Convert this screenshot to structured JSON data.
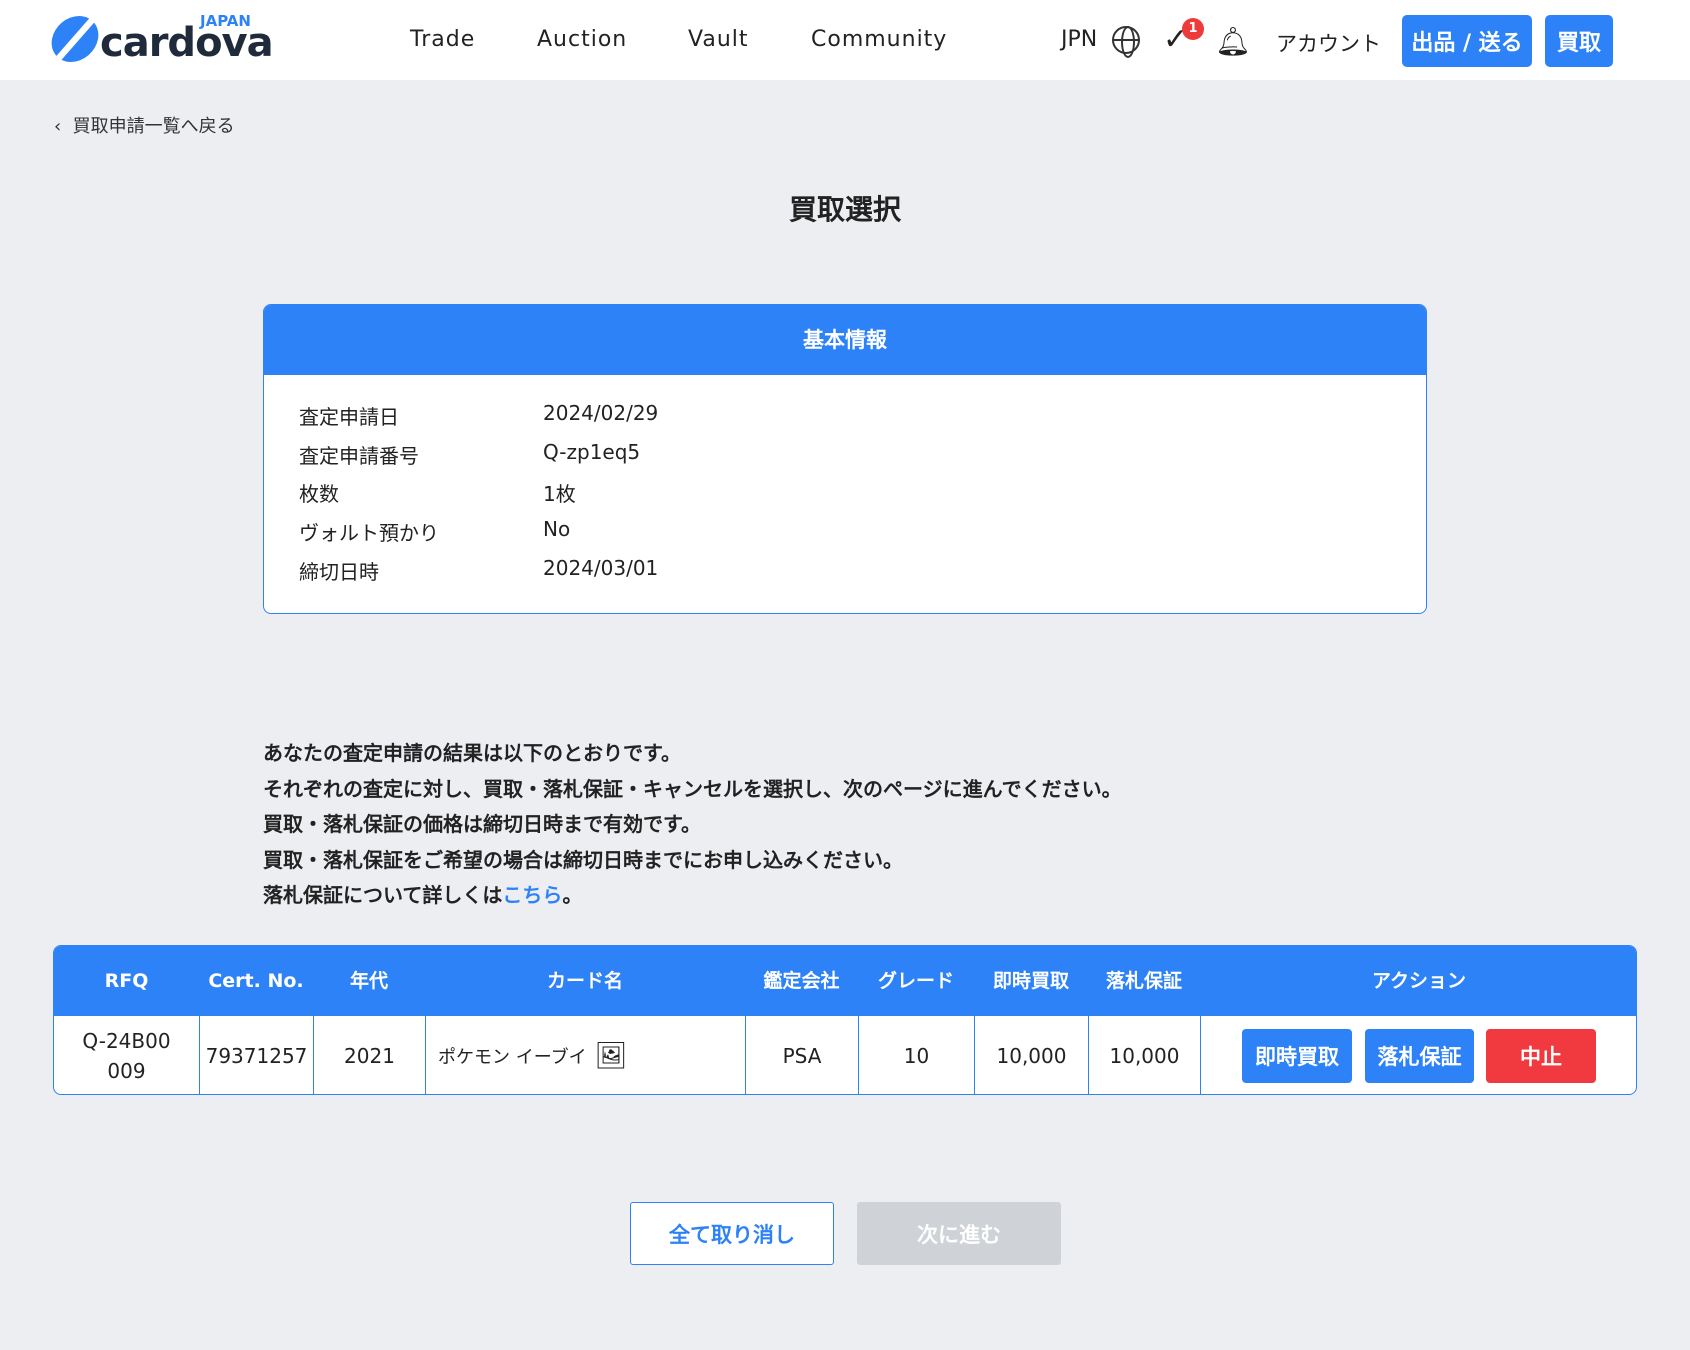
{
  "header": {
    "logo_text": "cardova",
    "logo_sub": "JAPAN",
    "nav": [
      "Trade",
      "Auction",
      "Vault",
      "Community"
    ],
    "lang": "JPN",
    "notif_count": "1",
    "account": "アカウント",
    "sell_button": "出品 / 送る",
    "buy_button": "買取"
  },
  "back_link": "買取申請一覧へ戻る",
  "page_title": "買取選択",
  "info": {
    "title": "基本情報",
    "rows": [
      {
        "label": "査定申請日",
        "value": "2024/02/29"
      },
      {
        "label": "査定申請番号",
        "value": "Q-zp1eq5"
      },
      {
        "label": "枚数",
        "value": "1枚"
      },
      {
        "label": "ヴォルト預かり",
        "value": "No"
      },
      {
        "label": "締切日時",
        "value": "2024/03/01"
      }
    ]
  },
  "message": {
    "lines": [
      "あなたの査定申請の結果は以下のとおりです。",
      "それぞれの査定に対し、買取・落札保証・キャンセルを選択し、次のページに進んでください。",
      "買取・落札保証の価格は締切日時まで有効です。",
      "買取・落札保証をご希望の場合は締切日時までにお申し込みください。"
    ],
    "last_prefix": "落札保証について詳しくは",
    "link": "こちら",
    "last_suffix": "。"
  },
  "table": {
    "headers": [
      "RFQ",
      "Cert. No.",
      "年代",
      "カード名",
      "鑑定会社",
      "グレード",
      "即時買取",
      "落札保証",
      "アクション"
    ],
    "row": {
      "rfq": "Q-24B00009",
      "cert": "79371257",
      "year": "2021",
      "card": "ポケモン イーブイ",
      "company": "PSA",
      "grade": "10",
      "instant": "10,000",
      "guarantee": "10,000"
    },
    "actions": {
      "instant": "即時買取",
      "guarantee": "落札保証",
      "cancel": "中止"
    }
  },
  "footer": {
    "cancel_all": "全て取り消し",
    "next": "次に進む"
  },
  "colors": {
    "primary": "#2e82f7",
    "danger": "#f03a3f",
    "disabled": "#cfd2d6"
  }
}
